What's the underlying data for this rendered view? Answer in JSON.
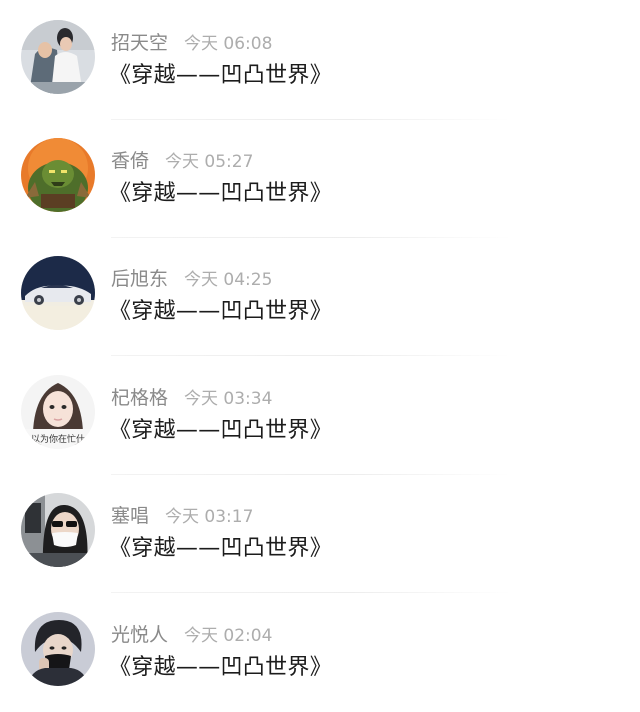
{
  "comments": [
    {
      "name": "招天空",
      "time": "今天 06:08",
      "message": "《穿越——凹凸世界》",
      "avatar_icon": "avatar-person-white-shirt-icon"
    },
    {
      "name": "香倚",
      "time": "今天 05:27",
      "message": "《穿越——凹凸世界》",
      "avatar_icon": "avatar-green-orc-icon"
    },
    {
      "name": "后旭东",
      "time": "今天 04:25",
      "message": "《穿越——凹凸世界》",
      "avatar_icon": "avatar-sports-car-icon"
    },
    {
      "name": "杞格格",
      "time": "今天 03:34",
      "message": "《穿越——凹凸世界》",
      "avatar_icon": "avatar-girl-portrait-icon",
      "avatar_caption": "以为你在忙什"
    },
    {
      "name": "塞唱",
      "time": "今天 03:17",
      "message": "《穿越——凹凸世界》",
      "avatar_icon": "avatar-person-mask-sunglasses-icon"
    },
    {
      "name": "光悦人",
      "time": "今天 02:04",
      "message": "《穿越——凹凸世界》",
      "avatar_icon": "avatar-man-black-mask-icon"
    }
  ],
  "colors": {
    "name": "#8a8a8a",
    "time": "#adadad",
    "message": "#1c1c1c",
    "background": "#ffffff"
  }
}
